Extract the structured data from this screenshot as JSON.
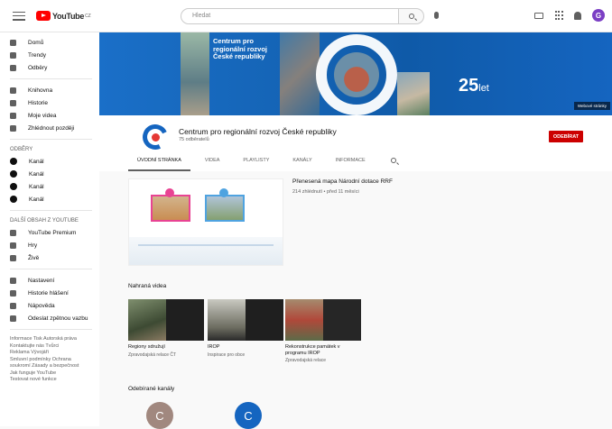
{
  "topbar": {
    "logo_text": "YouTube",
    "logo_region": "CZ",
    "search_placeholder": "Hledat",
    "avatar_letter": "G"
  },
  "sidebar": {
    "main": [
      {
        "label": "Domů",
        "icon": "home-icon"
      },
      {
        "label": "Trendy",
        "icon": "fire-icon"
      },
      {
        "label": "Odběry",
        "icon": "subscriptions-icon"
      }
    ],
    "library": [
      {
        "label": "Knihovna",
        "icon": "library-icon"
      },
      {
        "label": "Historie",
        "icon": "history-icon"
      },
      {
        "label": "Moje videa",
        "icon": "my-videos-icon"
      },
      {
        "label": "Zhlédnout později",
        "icon": "clock-icon"
      }
    ],
    "subscriptions_heading": "ODBĚRY",
    "subscriptions": [
      "Kanál",
      "Kanál",
      "Kanál",
      "Kanál"
    ],
    "more_heading": "DALŠÍ OBSAH Z YOUTUBE",
    "more": [
      {
        "label": "YouTube Premium",
        "icon": "premium-icon"
      },
      {
        "label": "Hry",
        "icon": "gaming-icon"
      },
      {
        "label": "Živě",
        "icon": "live-icon"
      }
    ],
    "settings": [
      {
        "label": "Nastavení",
        "icon": "settings-icon"
      },
      {
        "label": "Historie hlášení",
        "icon": "flag-icon"
      },
      {
        "label": "Nápověda",
        "icon": "help-icon"
      },
      {
        "label": "Odeslat zpětnou vazbu",
        "icon": "feedback-icon"
      }
    ],
    "footer": [
      "Informace Tisk Autorská práva",
      "Kontaktujte nás Tvůrci",
      "Reklama Vývojáři",
      "Smluvní podmínky Ochrana",
      "soukromí Zásady a bezpečnost",
      "Jak funguje YouTube",
      "Testovat nové funkce"
    ]
  },
  "banner": {
    "title": "Centrum pro regionální rozvoj České republiky",
    "anniversary": "25",
    "anniversary_suffix": "let",
    "link": "Webové stránky"
  },
  "channel": {
    "name": "Centrum pro regionální rozvoj České republiky",
    "subscribers": "75 odběratelů",
    "subscribe_label": "ODEBÍRAT"
  },
  "tabs": [
    "Úvodní stránka",
    "Videa",
    "Playlisty",
    "Kanály",
    "Informace"
  ],
  "featured": {
    "title": "Přenesená mapa Národní dotace RRF",
    "meta": "214 zhlédnutí • před 11 měsíci"
  },
  "sections": {
    "recent_title": "Nahraná videa",
    "channels_title": "Odebírané kanály"
  },
  "videos": [
    {
      "title": "Regiony sdružují",
      "meta": "Zpravodajská relace ČT"
    },
    {
      "title": "IROP",
      "meta": "Inspirace pro obce"
    },
    {
      "title": "Rekonstrukce památek v programu IROP",
      "meta": "Zpravodajská relace"
    }
  ],
  "channels": [
    {
      "letter": "C",
      "color": "#a1887f"
    },
    {
      "letter": "C",
      "color": "#1565c0"
    }
  ],
  "colors": {
    "subscribe": "#cc0000",
    "banner": "#1565c0",
    "accent_red": "#e53935"
  }
}
